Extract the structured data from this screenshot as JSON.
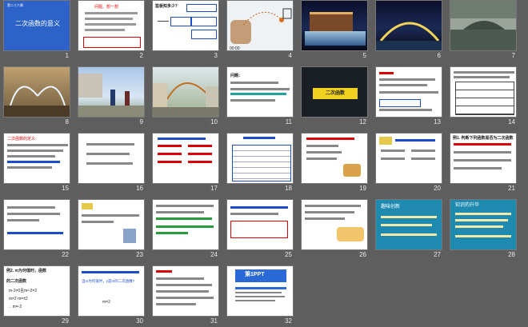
{
  "slides": [
    {
      "num": "1",
      "text": [
        "二次函数的意义"
      ]
    },
    {
      "num": "2",
      "text": [
        "问题，想一想"
      ]
    },
    {
      "num": "3",
      "text": [
        "篮板知多少？"
      ]
    },
    {
      "num": "4",
      "text": [
        "00:00"
      ]
    },
    {
      "num": "5",
      "text": []
    },
    {
      "num": "6",
      "text": []
    },
    {
      "num": "7",
      "text": []
    },
    {
      "num": "8",
      "text": []
    },
    {
      "num": "9",
      "text": []
    },
    {
      "num": "10",
      "text": []
    },
    {
      "num": "11",
      "text": [
        "问题："
      ]
    },
    {
      "num": "12",
      "text": [
        "二次函数"
      ]
    },
    {
      "num": "13",
      "text": []
    },
    {
      "num": "14",
      "text": []
    },
    {
      "num": "15",
      "text": [
        "二次函数的定义"
      ]
    },
    {
      "num": "16",
      "text": []
    },
    {
      "num": "17",
      "text": []
    },
    {
      "num": "18",
      "text": []
    },
    {
      "num": "19",
      "text": []
    },
    {
      "num": "20",
      "text": []
    },
    {
      "num": "21",
      "text": [
        "例1. 判断下列函数是否为二次函数"
      ]
    },
    {
      "num": "22",
      "text": []
    },
    {
      "num": "23",
      "text": []
    },
    {
      "num": "24",
      "text": []
    },
    {
      "num": "25",
      "text": []
    },
    {
      "num": "26",
      "text": []
    },
    {
      "num": "27",
      "text": [
        "趣味创新"
      ]
    },
    {
      "num": "28",
      "text": [
        "知识的升华"
      ]
    },
    {
      "num": "29",
      "text": [
        "例2. m为何值时，函数",
        "的二次函数",
        "m-2≠0且m²-2=2",
        "m≠2  m=±2",
        "∴  m=-2"
      ]
    },
    {
      "num": "30",
      "text": [
        "当m为何值时，y是m的二次函数?",
        "m=2"
      ]
    },
    {
      "num": "31",
      "text": []
    },
    {
      "num": "32",
      "text": [
        "第1PPT"
      ]
    }
  ]
}
